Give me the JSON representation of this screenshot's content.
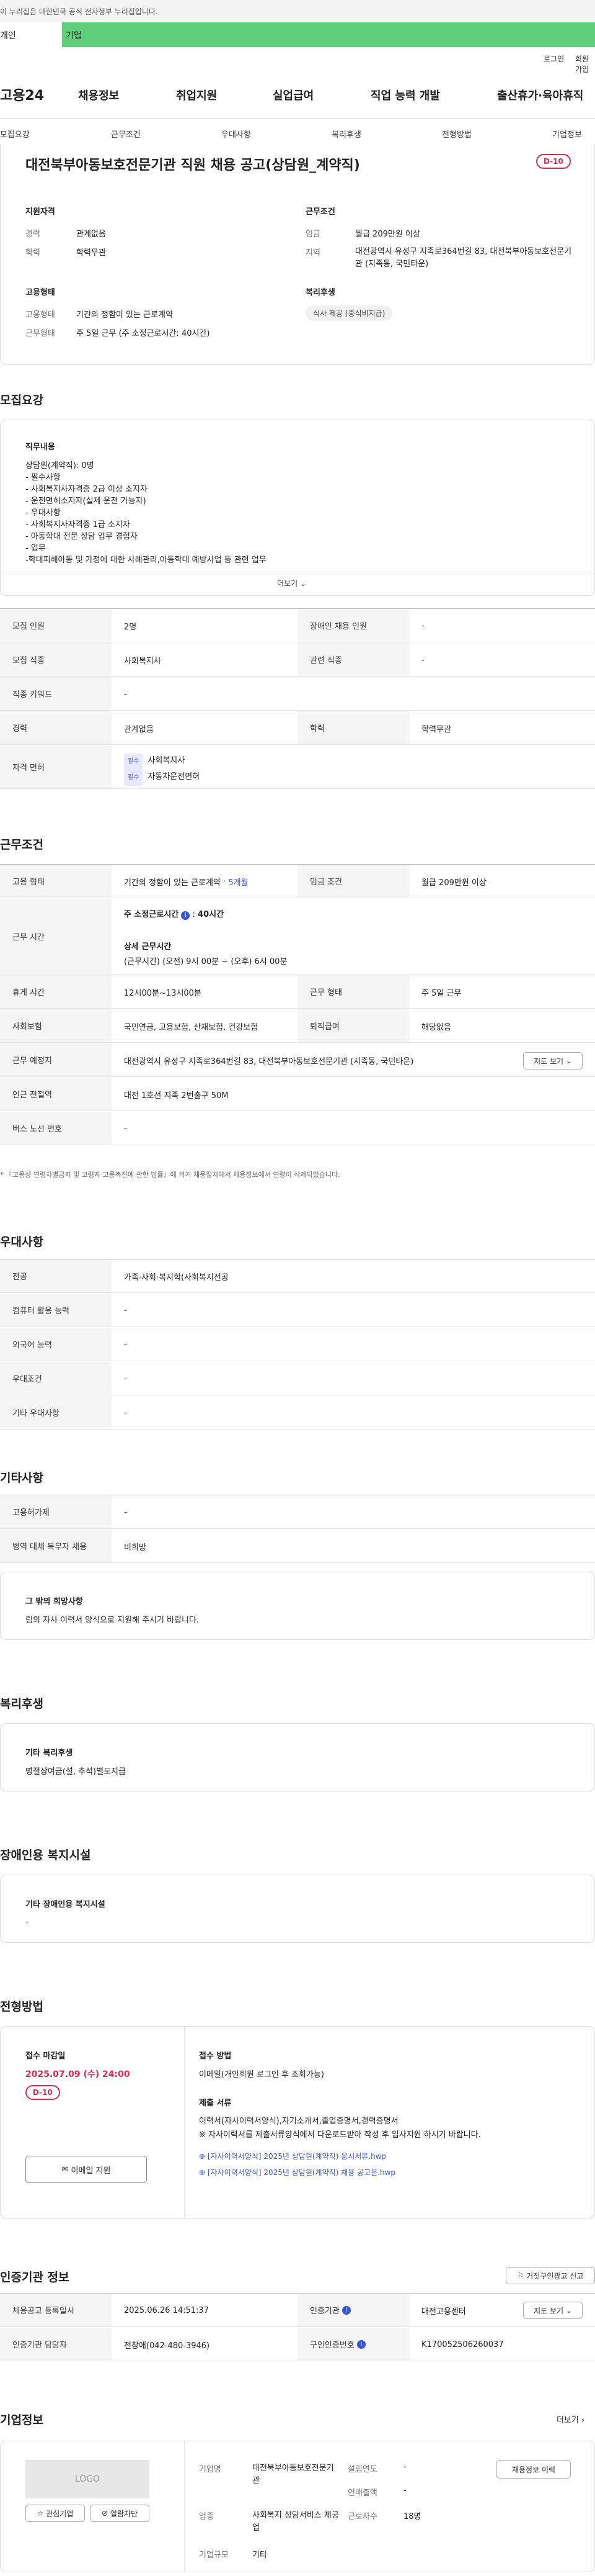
{
  "gov_banner": {
    "text": "이 누리집은 대한민국 공식 전자정부 누리집입니다."
  },
  "top_tabs": {
    "personal": "개인",
    "company": "기업"
  },
  "utility": {
    "login": "로그인",
    "join": "회원가입"
  },
  "site": {
    "logo": "고용24"
  },
  "gnb": [
    "채용정보",
    "취업지원",
    "실업급여",
    "직업 능력 개발",
    "출산휴가·육아휴직"
  ],
  "subnav": [
    "모집요강",
    "근무조건",
    "우대사항",
    "복리후생",
    "전형방법",
    "기업정보"
  ],
  "summary": {
    "title": "대전북부아동보호전문기관 직원 채용 공고(상담원_계약직)",
    "dday": "D-10",
    "qual_title": "지원자격",
    "career_label": "경력",
    "career_value": "관계없음",
    "edu_label": "학력",
    "edu_value": "학력무관",
    "cond_title": "근무조건",
    "wage_label": "임금",
    "wage_value": "월급 209만원 이상",
    "region_label": "지역",
    "region_value": "대전광역시 유성구 지족로364번길 83, 대전북부아동보호전문기관 (지족동, 국민타운)",
    "emp_title": "고용형태",
    "emptype_label": "고용형태",
    "emptype_value": "기간의 정함이 있는 근로계약",
    "workform_label": "근무형태",
    "workform_value": "주 5일 근무 (주 소정근로시간: 40시간)",
    "welfare_title": "복리후생",
    "welfare_chip": "식사 제공 (중식비지급)"
  },
  "recruit": {
    "heading": "모집요강",
    "duty_title": "직무내용",
    "duty_lines": [
      "상담원(계약직): 0명",
      "- 필수사항",
      "- 사회복지사자격증 2급 이상 소지자",
      "- 운전면허소지자(실제 운전 가능자)",
      "- 우대사항",
      "- 사회복지사자격증 1급 소지자",
      "- 아동학대 전문 상담 업무 경험자",
      "- 업무",
      "-학대피해아동 및 가정에 대한 사례관리,아동학대 예방사업 등 관련 업무"
    ],
    "more": "더보기",
    "rows": {
      "count_label": "모집 인원",
      "count_value": "2명",
      "disabled_label": "장애인 채용 인원",
      "disabled_value": "-",
      "job_label": "모집 직종",
      "job_value": "사회복지사",
      "related_label": "관련 직종",
      "related_value": "-",
      "keyword_label": "직종 키워드",
      "keyword_value": "-",
      "career_label": "경력",
      "career_value": "관계없음",
      "edu_label": "학력",
      "edu_value": "학력무관",
      "license_label": "자격 면허",
      "licenses": [
        {
          "badge": "필수",
          "name": "사회복지사"
        },
        {
          "badge": "필수",
          "name": "자동차운전면허"
        }
      ]
    }
  },
  "work": {
    "heading": "근무조건",
    "emptype_label": "고용 형태",
    "emptype_value": "기간의 정함이 있는 근로계약",
    "emptype_period": "5개월",
    "wage_label": "임금 조건",
    "wage_value": "월급 209만원 이상",
    "hours_label": "근무 시간",
    "hours_week_title": "주 소정근로시간",
    "hours_week_value": "40시간",
    "hours_detail_title": "상세 근무시간",
    "hours_detail_value": "(근무시간) (오전) 9시 00분 ~ (오후) 6시 00분",
    "break_label": "휴게 시간",
    "break_value": "12시00분~13시00분",
    "form_label": "근무 형태",
    "form_value": "주 5일 근무",
    "insurance_label": "사회보험",
    "insurance_value": "국민연금, 고용보험, 산재보험, 건강보험",
    "retire_label": "퇴직급여",
    "retire_value": "해당없음",
    "place_label": "근무 예정지",
    "place_value": "대전광역시 유성구 지족로364번길 83, 대전북부아동보호전문기관 (지족동, 국민타운)",
    "map_btn": "지도 보기",
    "subway_label": "인근 전철역",
    "subway_value": "대전 1호선 지족 2번출구 50M",
    "bus_label": "버스 노선 번호",
    "bus_value": "-",
    "note": "* 『고용상 연령차별금지 및 고령자 고용촉진에 관한 법률』에 의거 채용절차에서 채용정보에서 연령이 삭제되었습니다."
  },
  "prefer": {
    "heading": "우대사항",
    "major_label": "전공",
    "major_value": "가족·사회·복지학(사회복지전공",
    "computer_label": "컴퓨터 활용 능력",
    "computer_value": "-",
    "lang_label": "외국어 능력",
    "lang_value": "-",
    "cond_label": "우대조건",
    "cond_value": "-",
    "etc_label": "기타 우대사항",
    "etc_value": "-"
  },
  "other": {
    "heading": "기타사항",
    "permit_label": "고용허가제",
    "permit_value": "-",
    "military_label": "병역 대체 복무자 채용",
    "military_value": "비희망",
    "wish_title": "그 밖의 희망사항",
    "wish_text": "림의 자사 이력서 양식으로 지원해 주시기 바랍니다."
  },
  "benefit": {
    "heading": "복리후생",
    "box_title": "기타 복리후생",
    "box_text": "명절상여금(설, 추석)별도지급"
  },
  "facility": {
    "heading": "장애인용 복지시설",
    "box_title": "기타 장애인용 복지시설",
    "box_text": "-"
  },
  "process": {
    "heading": "전형방법",
    "deadline_title": "접수 마감일",
    "deadline_value": "2025.07.09 (수) 24:00",
    "dday": "D-10",
    "apply_btn": "이메일 지원",
    "method_title": "접수 방법",
    "method_value": "이메일(개인회원 로그인 후 조회가능)",
    "docs_title": "제출 서류",
    "docs_lines": [
      "이력서(자사이력서양식),자기소개서,졸업증명서,경력증명서",
      "※ 자사이력서를 제출서류양식에서 다운로드받아 작성 후 입사지원 하시기 바랍니다."
    ],
    "files": [
      "[자사이력서양식] 2025년 상담원(계약직) 응시서류.hwp",
      "[자사이력서양식] 2025년 상담원(계약직) 채용 공고문.hwp"
    ]
  },
  "auth": {
    "heading": "인증기관 정보",
    "report_btn": "거짓구인광고 신고",
    "reg_label": "채용공고 등록일시",
    "reg_value": "2025.06.26 14:51:37",
    "org_label": "인증기관",
    "org_value": "대전고용센터",
    "map_btn": "지도 보기",
    "manager_label": "인증기관 담당자",
    "manager_value": "전창애(042-480-3946)",
    "number_label": "구인인증번호",
    "number_value": "K170052506260037"
  },
  "company": {
    "heading": "기업정보",
    "more": "더보기",
    "logo_text": "LOGO",
    "interest_btn": "관심기업",
    "block_btn": "열람차단",
    "name_label": "기업명",
    "name_value": "대전북부아동보호전문기관",
    "founded_label": "설립연도",
    "founded_value": "-",
    "sales_label": "연매출액",
    "sales_value": "-",
    "industry_label": "업종",
    "industry_value": "사회복지 상담서비스 제공업",
    "staff_label": "근로자수",
    "staff_value": "18명",
    "size_label": "기업규모",
    "size_value": "기타",
    "jobs_btn": "채용정보 이력"
  }
}
